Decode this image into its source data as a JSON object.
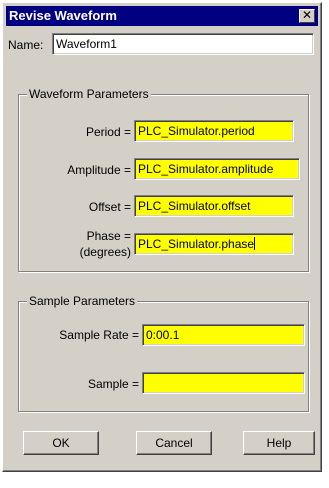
{
  "dialog": {
    "title": "Revise Waveform",
    "close_glyph": "✕"
  },
  "name_field": {
    "label": "Name:",
    "value": "Waveform1"
  },
  "waveform_parameters": {
    "title": "Waveform Parameters",
    "period": {
      "label": "Period =",
      "value": "PLC_Simulator.period"
    },
    "amplitude": {
      "label": "Amplitude =",
      "value": "PLC_Simulator.amplitude"
    },
    "offset": {
      "label": "Offset =",
      "value": "PLC_Simulator.offset"
    },
    "phase": {
      "label_line1": "Phase =",
      "label_line2": "(degrees)",
      "value": "PLC_Simulator.phase"
    }
  },
  "sample_parameters": {
    "title": "Sample Parameters",
    "sample_rate": {
      "label": "Sample Rate =",
      "value": "0:00.1"
    },
    "sample": {
      "label": "Sample =",
      "value": ""
    }
  },
  "buttons": {
    "ok": "OK",
    "cancel": "Cancel",
    "help": "Help"
  },
  "colors": {
    "titlebar": "#000080",
    "dialog_face": "#d4d0c8",
    "highlight_field": "#ffff00"
  }
}
